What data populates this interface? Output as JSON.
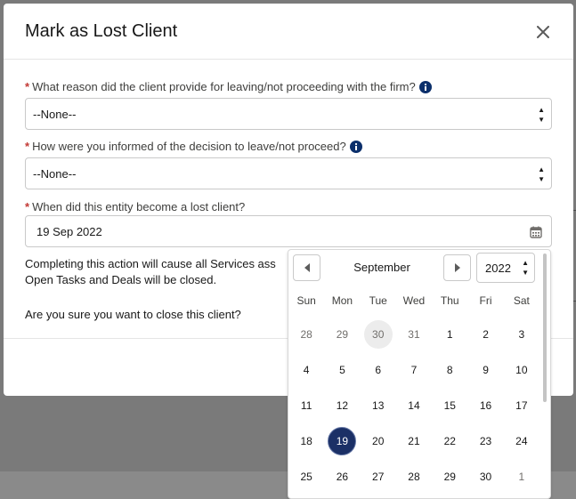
{
  "modal": {
    "title": "Mark as Lost Client",
    "close_label": "close-icon"
  },
  "fields": {
    "reason": {
      "required_mark": "*",
      "label": "What reason did the client provide for leaving/not proceeding with the firm?",
      "value": "--None--"
    },
    "informed": {
      "required_mark": "*",
      "label": "How were you informed of the decision to leave/not proceed?",
      "value": "--None--"
    },
    "lost_date": {
      "required_mark": "*",
      "label": "When did this entity become a lost client?",
      "value": "19 Sep 2022"
    }
  },
  "body_text": {
    "line1": "Completing this action will cause all Services ass",
    "line2": "Open Tasks and Deals will be closed.",
    "confirm": "Are you sure you want to close this client?"
  },
  "datepicker": {
    "month": "September",
    "year": "2022",
    "weekdays": [
      "Sun",
      "Mon",
      "Tue",
      "Wed",
      "Thu",
      "Fri",
      "Sat"
    ],
    "weeks": [
      [
        "28",
        "29",
        "30",
        "31",
        "1",
        "2",
        "3"
      ],
      [
        "4",
        "5",
        "6",
        "7",
        "8",
        "9",
        "10"
      ],
      [
        "11",
        "12",
        "13",
        "14",
        "15",
        "16",
        "17"
      ],
      [
        "18",
        "19",
        "20",
        "21",
        "22",
        "23",
        "24"
      ],
      [
        "25",
        "26",
        "27",
        "28",
        "29",
        "30",
        "1"
      ]
    ],
    "selected_day": "19",
    "today_day": "30"
  },
  "colors": {
    "required": "#c23934",
    "info_icon": "#0b2f6b",
    "selected": "#1b3066"
  }
}
